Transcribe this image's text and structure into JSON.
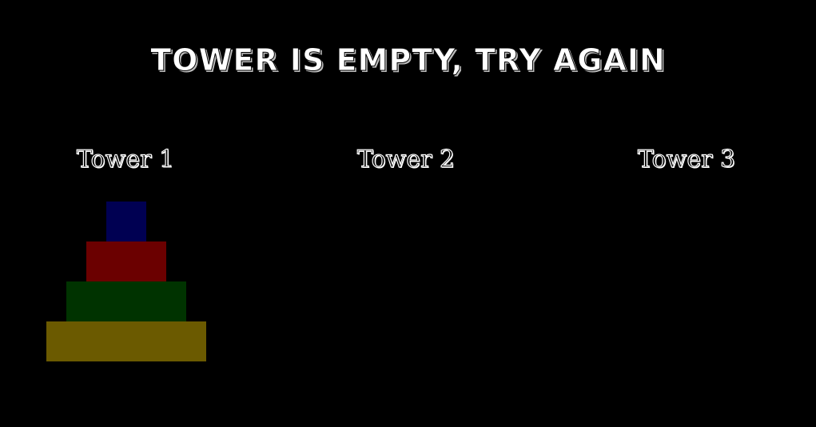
{
  "status": {
    "message": "Tower is empty, try again"
  },
  "towers": [
    {
      "label": "Tower 1",
      "disks": [
        "#000052",
        "#6b0000",
        "#003300",
        "#6b5a00"
      ]
    },
    {
      "label": "Tower 2",
      "disks": []
    },
    {
      "label": "Tower 3",
      "disks": []
    }
  ]
}
